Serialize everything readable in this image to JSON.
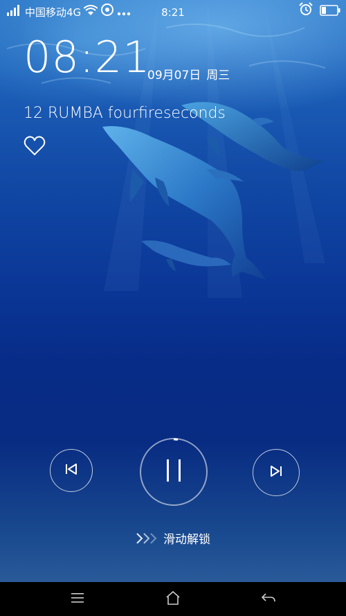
{
  "status_bar": {
    "carrier": "中国移动4G",
    "time": "8:21",
    "icons": [
      "signal-icon",
      "wifi-icon",
      "notification-icon",
      "more-icon",
      "alarm-icon",
      "battery-icon"
    ]
  },
  "lockscreen": {
    "clock": "08:21",
    "date": "09月07日",
    "weekday": "周三",
    "song_title": "12 RUMBA fourfireseconds",
    "unlock_hint": "滑动解锁"
  },
  "music_controls": {
    "prev_icon": "skip-previous-icon",
    "play_pause_icon": "pause-icon",
    "next_icon": "skip-next-icon",
    "progress": 0.02
  },
  "nav_bar": {
    "icons": [
      "menu-icon",
      "home-icon",
      "back-icon"
    ]
  },
  "colors": {
    "accent": "#ffffff",
    "water_top": "#2f79c9",
    "water_deep": "#072c88",
    "nav_bg": "#000000"
  }
}
